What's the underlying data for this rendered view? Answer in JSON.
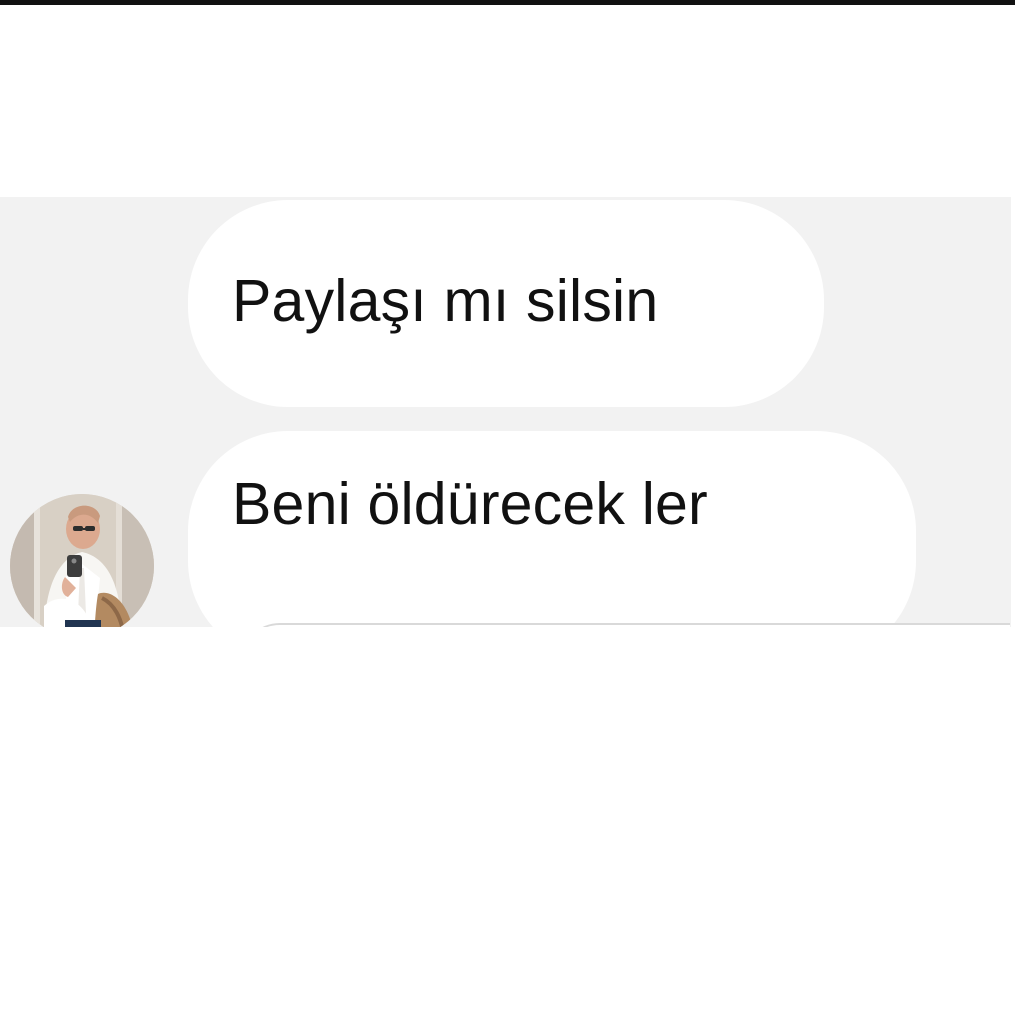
{
  "conversation": {
    "messages": [
      {
        "text": "Paylaşı mı silsin"
      },
      {
        "text": "Beni öldürecek ler"
      }
    ],
    "avatar_icon": "profile-photo"
  },
  "colors": {
    "strip_background": "#f2f2f2",
    "bubble_background": "#ffffff",
    "text": "#111111"
  }
}
